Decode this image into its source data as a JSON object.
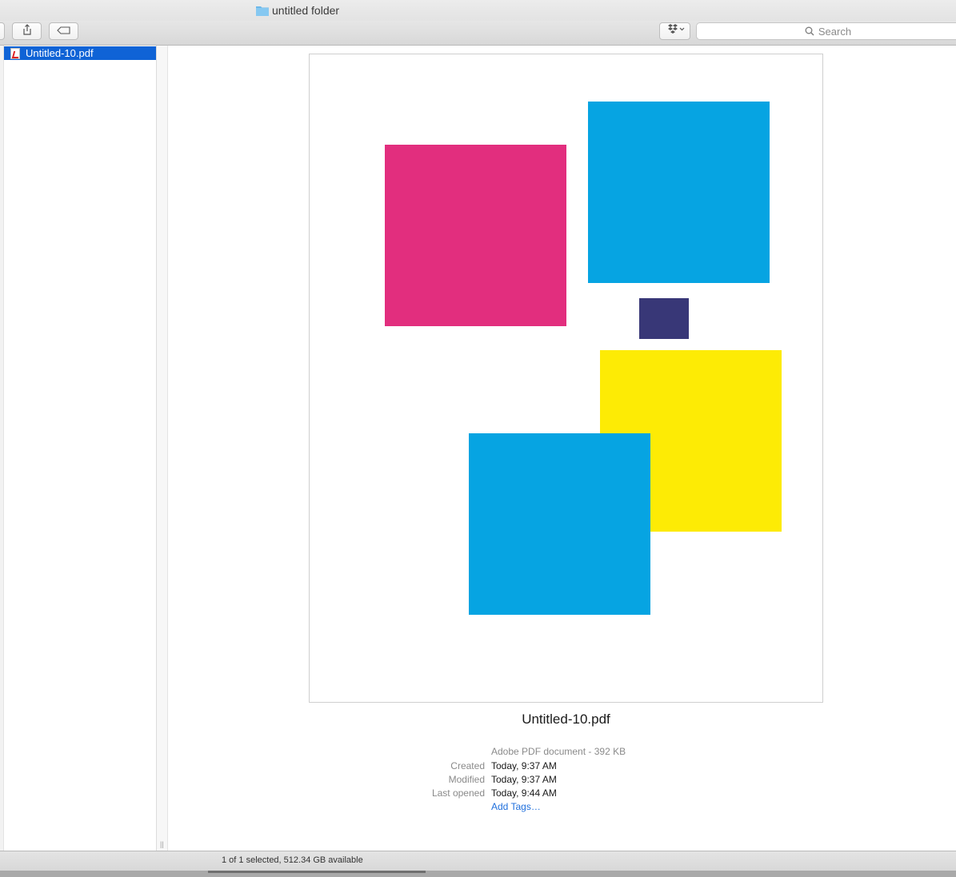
{
  "window": {
    "title": "untitled folder"
  },
  "toolbar": {
    "share_icon": "share-icon",
    "tag_icon": "tag-icon",
    "dropbox_icon": "dropbox-icon",
    "search_placeholder": "Search"
  },
  "sidebar": {
    "items": [
      {
        "label": "Untitled-10.pdf",
        "selected": true,
        "icon": "pdf-file-icon"
      }
    ]
  },
  "preview": {
    "file_name": "Untitled-10.pdf",
    "kind": "Adobe PDF document - 392 KB",
    "meta": [
      {
        "label": "Created",
        "value": "Today, 9:37 AM"
      },
      {
        "label": "Modified",
        "value": "Today, 9:37 AM"
      },
      {
        "label": "Last opened",
        "value": "Today, 9:44 AM"
      }
    ],
    "add_tags": "Add Tags…"
  },
  "colors": {
    "selection": "#0f63d6",
    "magenta": "#e22e7e",
    "cyan": "#06a4e2",
    "navy": "#383777",
    "yellow": "#fdeb05"
  },
  "status": {
    "text": "1 of 1 selected, 512.34 GB available"
  }
}
